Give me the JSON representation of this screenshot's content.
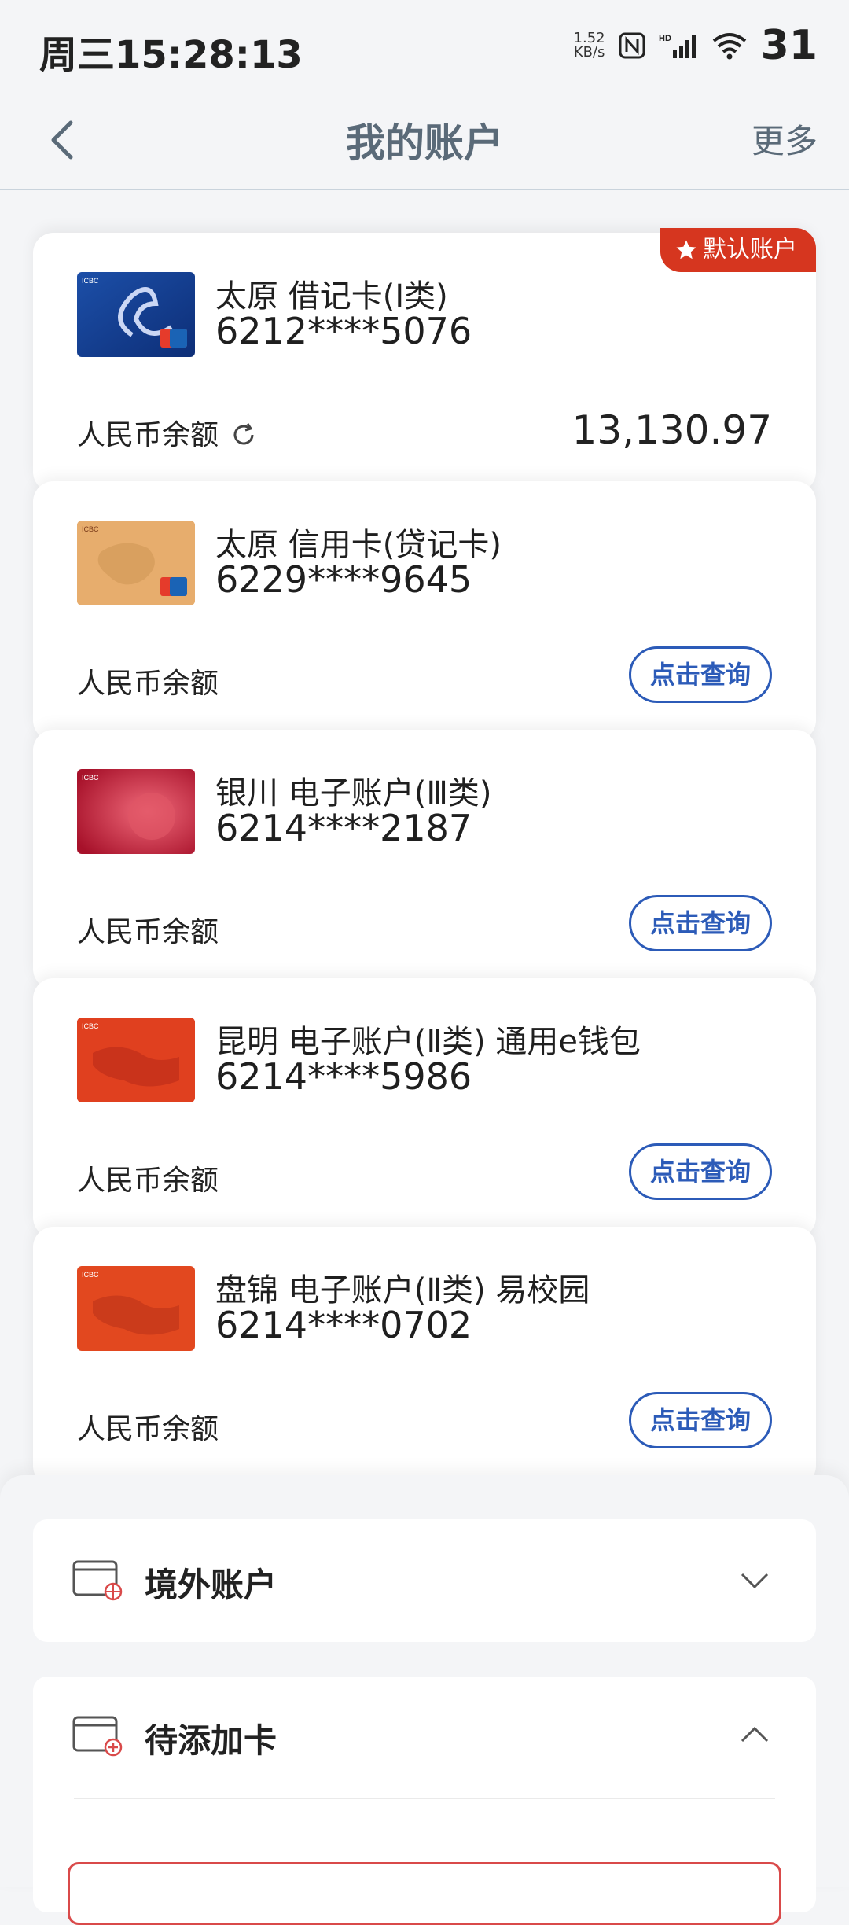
{
  "status_bar": {
    "time": "周三15:28:13",
    "net_speed_value": "1.52",
    "net_speed_unit": "KB/s",
    "battery": "31"
  },
  "header": {
    "title": "我的账户",
    "more": "更多"
  },
  "accounts": [
    {
      "name": "太原 借记卡(Ⅰ类)",
      "number": "6212****5076",
      "balance_label": "人民币余额",
      "balance_value": "13,130.97",
      "is_default": true,
      "default_label": "默认账户"
    },
    {
      "name": "太原 信用卡(贷记卡)",
      "number": "6229****9645",
      "balance_label": "人民币余额",
      "query_label": "点击查询"
    },
    {
      "name": "银川 电子账户(Ⅲ类)",
      "number": "6214****2187",
      "balance_label": "人民币余额",
      "query_label": "点击查询"
    },
    {
      "name": "昆明 电子账户(Ⅱ类) 通用e钱包",
      "number": "6214****5986",
      "balance_label": "人民币余额",
      "query_label": "点击查询"
    },
    {
      "name": "盘锦 电子账户(Ⅱ类) 易校园",
      "number": "6214****0702",
      "balance_label": "人民币余额",
      "query_label": "点击查询"
    }
  ],
  "sections": {
    "overseas": {
      "title": "境外账户",
      "expanded": false
    },
    "pending": {
      "title": "待添加卡",
      "expanded": true
    }
  },
  "colors": {
    "accent_blue": "#2c5bb8",
    "default_badge": "#d6361f",
    "header_text": "#5a6a78"
  }
}
